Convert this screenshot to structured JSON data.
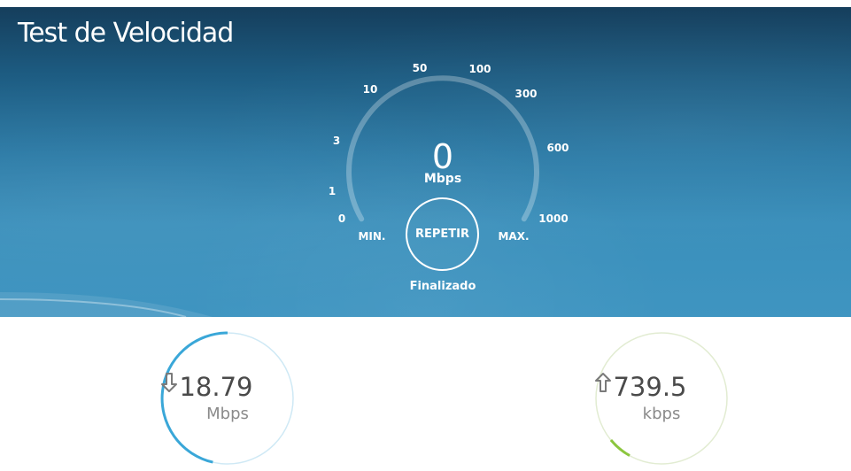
{
  "header": {
    "title": "Test de Velocidad"
  },
  "gauge": {
    "scale_labels": [
      "0",
      "1",
      "3",
      "10",
      "50",
      "100",
      "300",
      "600",
      "1000"
    ],
    "min_label": "MIN.",
    "max_label": "MAX.",
    "current_value": "0",
    "current_unit": "Mbps",
    "repeat_label": "REPETIR",
    "status": "Finalizado"
  },
  "results": {
    "download": {
      "value": "18.79",
      "unit": "Mbps",
      "icon": "download-arrow-icon",
      "ring_color": "#3aa7d8"
    },
    "upload": {
      "value": "739.5",
      "unit": "kbps",
      "icon": "upload-arrow-icon",
      "ring_color": "#8cc63f"
    }
  },
  "colors": {
    "hero_top": "#153e5c",
    "hero_bottom": "#3f95c1",
    "text_white": "#ffffff",
    "value_text": "#4a4a4a"
  }
}
